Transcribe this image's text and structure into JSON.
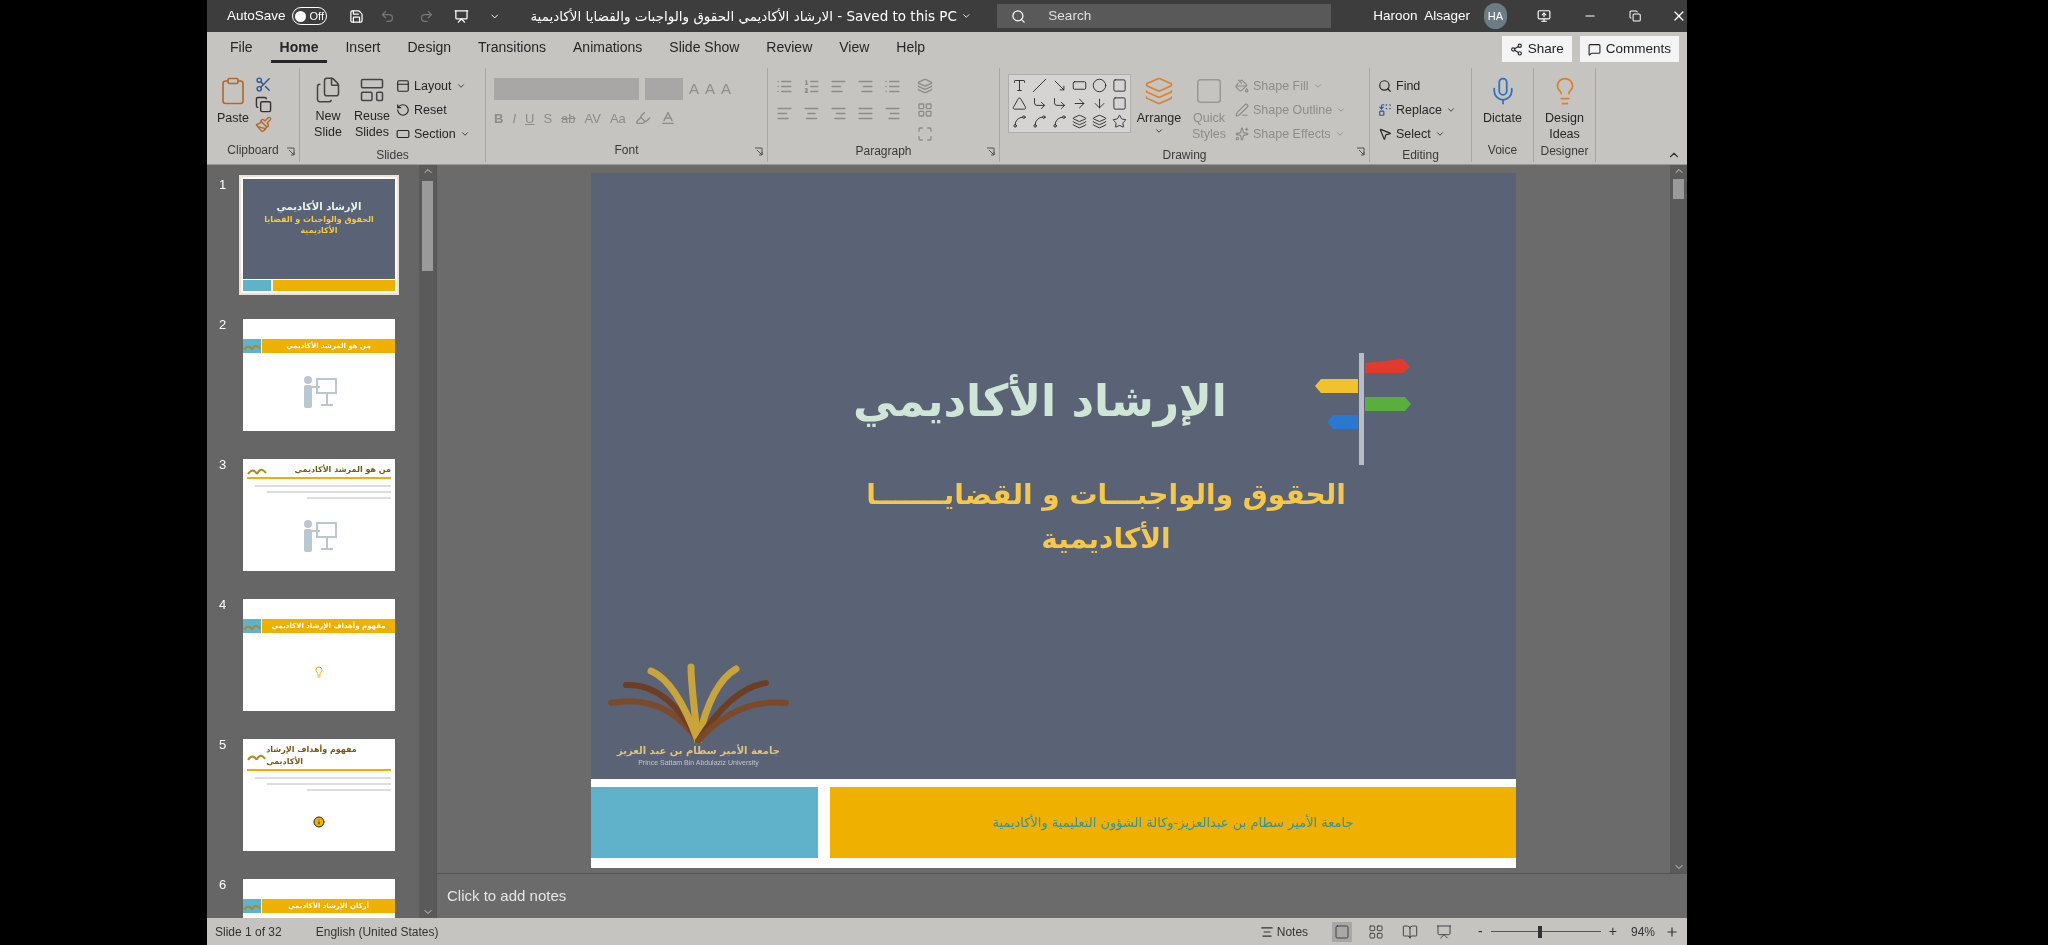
{
  "titlebar": {
    "autosave_label": "AutoSave",
    "autosave": {
      "on": false,
      "label": "Off"
    },
    "title": "الارشاد الأكاديمي الحقوق والواجبات والقضايا الأكاديمية  -  Saved to this PC",
    "search": {
      "placeholder": "Search"
    },
    "user": "Haroon  Alsager",
    "avatar": "HA"
  },
  "tabs": [
    {
      "label": "File",
      "selected": false
    },
    {
      "label": "Home",
      "selected": true
    },
    {
      "label": "Insert",
      "selected": false
    },
    {
      "label": "Design",
      "selected": false
    },
    {
      "label": "Transitions",
      "selected": false
    },
    {
      "label": "Animations",
      "selected": false
    },
    {
      "label": "Slide Show",
      "selected": false
    },
    {
      "label": "Review",
      "selected": false
    },
    {
      "label": "View",
      "selected": false
    },
    {
      "label": "Help",
      "selected": false
    }
  ],
  "actions": [
    {
      "kind": "share",
      "label": "Share"
    },
    {
      "kind": "comments",
      "label": "Comments"
    }
  ],
  "ribbon": {
    "groups": [
      {
        "kind": "clipboard",
        "name": "Clipboard",
        "launcher": true,
        "items": [
          {
            "label": "Paste",
            "disabled": false
          }
        ]
      },
      {
        "kind": "slides",
        "name": "Slides",
        "items": [
          {
            "label": "New Slide",
            "disabled": false
          },
          {
            "label": "Reuse Slides",
            "disabled": false
          },
          {
            "label": "Layout",
            "disabled": false
          },
          {
            "label": "Reset",
            "disabled": false
          },
          {
            "label": "Section",
            "disabled": false
          }
        ]
      },
      {
        "kind": "font",
        "name": "Font",
        "launcher": true,
        "fields": [
          {
            "kind": "name",
            "disabled": true
          },
          {
            "kind": "size",
            "disabled": true
          }
        ],
        "size_buttons": [
          {
            "label": "A",
            "disabled": true
          },
          {
            "label": "A",
            "disabled": true
          },
          {
            "label": "A",
            "disabled": true
          }
        ],
        "items": [
          {
            "label": "B",
            "disabled": true
          },
          {
            "label": "I",
            "disabled": true
          },
          {
            "label": "U",
            "disabled": true
          },
          {
            "label": "S",
            "disabled": true
          },
          {
            "label": "ab",
            "disabled": true
          },
          {
            "label": "AV",
            "disabled": true
          },
          {
            "label": "Aa",
            "disabled": true
          }
        ]
      },
      {
        "kind": "paragraph",
        "name": "Paragraph",
        "launcher": true,
        "disabled": true
      },
      {
        "kind": "drawing",
        "name": "Drawing",
        "launcher": true,
        "items": [
          {
            "label": "Arrange",
            "disabled": false
          },
          {
            "label": "Quick Styles",
            "disabled": true
          },
          {
            "label": "Shape Fill",
            "disabled": true
          },
          {
            "label": "Shape Outline",
            "disabled": true
          },
          {
            "label": "Shape Effects",
            "disabled": true
          }
        ]
      },
      {
        "kind": "editing",
        "name": "Editing",
        "items": [
          {
            "label": "Find",
            "disabled": false
          },
          {
            "label": "Replace",
            "disabled": false
          },
          {
            "label": "Select",
            "disabled": false
          }
        ]
      },
      {
        "kind": "voice",
        "name": "Voice",
        "items": [
          {
            "label": "Dictate",
            "disabled": false
          }
        ]
      },
      {
        "kind": "designer",
        "name": "Designer",
        "items": [
          {
            "label": "Design Ideas",
            "disabled": false
          }
        ]
      }
    ]
  },
  "thumbnails": [
    {
      "number": "1",
      "selected": true,
      "kind": "title",
      "title": "الإرشاد الأكاديمي",
      "subtitle": "الحقوق والواجبات و القضايا الأكاديمية"
    },
    {
      "number": "2",
      "selected": false,
      "kind": "presenter",
      "title": "من هو المرشد الأكاديمي"
    },
    {
      "number": "3",
      "selected": false,
      "kind": "lecture",
      "title": "من هو المرشد الأكاديمي"
    },
    {
      "number": "4",
      "selected": false,
      "kind": "idea",
      "title": "مفهوم وأهداف الإرشاد الاكاديمي"
    },
    {
      "number": "5",
      "selected": false,
      "kind": "info",
      "title": "مفهوم وأهداف الإرشاد الأكاديمي"
    },
    {
      "number": "6",
      "selected": false,
      "kind": "banner",
      "title": "أركان الإرشاد الأكاديمي"
    }
  ],
  "slide": {
    "title": "الإرشاد الأكاديمي",
    "subtitle_lines": [
      "الحقوق والواجبـــات و القضايـــــــا",
      "الأكاديمية"
    ],
    "logo": {
      "arabic": "جامعة الأمير سطام بن عبد العزيز",
      "english": "Prince Sattam Bin Abdulaziz University"
    },
    "footer": "جامعة الأمير سطام بن عبدالعزيز-وكالة الشؤون التعليمية والأكاديمية"
  },
  "notes": {
    "placeholder": "Click to add notes"
  },
  "status_bar": {
    "slide_info": "Slide 1 of 32",
    "language": "English (United States)",
    "notes": "Notes",
    "views": [
      {
        "kind": "normal",
        "selected": true
      },
      {
        "kind": "sorter",
        "selected": false
      },
      {
        "kind": "reading",
        "selected": false
      },
      {
        "kind": "slideshow",
        "selected": false
      }
    ],
    "zoom": {
      "minus": "-",
      "plus": "+",
      "level": 0.45,
      "value": "94%"
    }
  }
}
